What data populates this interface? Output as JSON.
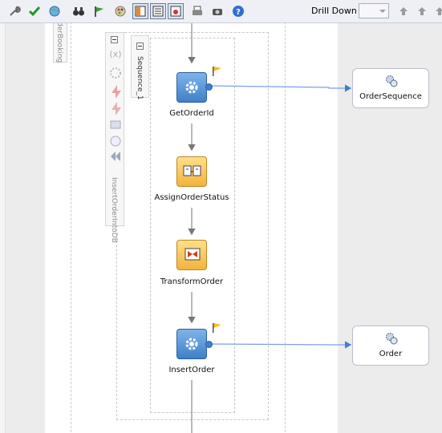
{
  "toolbar": {
    "buttons": [
      {
        "name": "wrench-icon",
        "pressed": false
      },
      {
        "name": "validate-check-icon",
        "pressed": false
      },
      {
        "name": "globe-refresh-icon",
        "pressed": false
      },
      {
        "name": "binoculars-icon",
        "pressed": false
      },
      {
        "name": "flag-icon",
        "pressed": false
      },
      {
        "name": "palette-icon",
        "pressed": false
      },
      {
        "name": "layout-columns-icon",
        "pressed": true
      },
      {
        "name": "list-view-icon",
        "pressed": true
      },
      {
        "name": "stamp-icon",
        "pressed": true
      },
      {
        "name": "print-icon",
        "pressed": false
      },
      {
        "name": "camera-icon",
        "pressed": false
      },
      {
        "name": "help-icon",
        "pressed": false
      }
    ],
    "drill_down_label": "Drill Down Stack:",
    "drill_down_value": ""
  },
  "process": {
    "scope_label": "derBooking",
    "flow_label": "InsertOrderIntoDB",
    "sequence_label": "Sequence_1",
    "activities": [
      {
        "name": "GetOrderId",
        "kind": "invoke"
      },
      {
        "name": "AssignOrderStatus",
        "kind": "assign"
      },
      {
        "name": "TransformOrder",
        "kind": "transform"
      },
      {
        "name": "InsertOrder",
        "kind": "invoke"
      }
    ]
  },
  "partner_links": [
    {
      "name": "OrderSequence"
    },
    {
      "name": "Order"
    }
  ],
  "colors": {
    "invoke": "#4a8ad4",
    "assign": "#f4c050",
    "connector": "#7a9ff0"
  }
}
